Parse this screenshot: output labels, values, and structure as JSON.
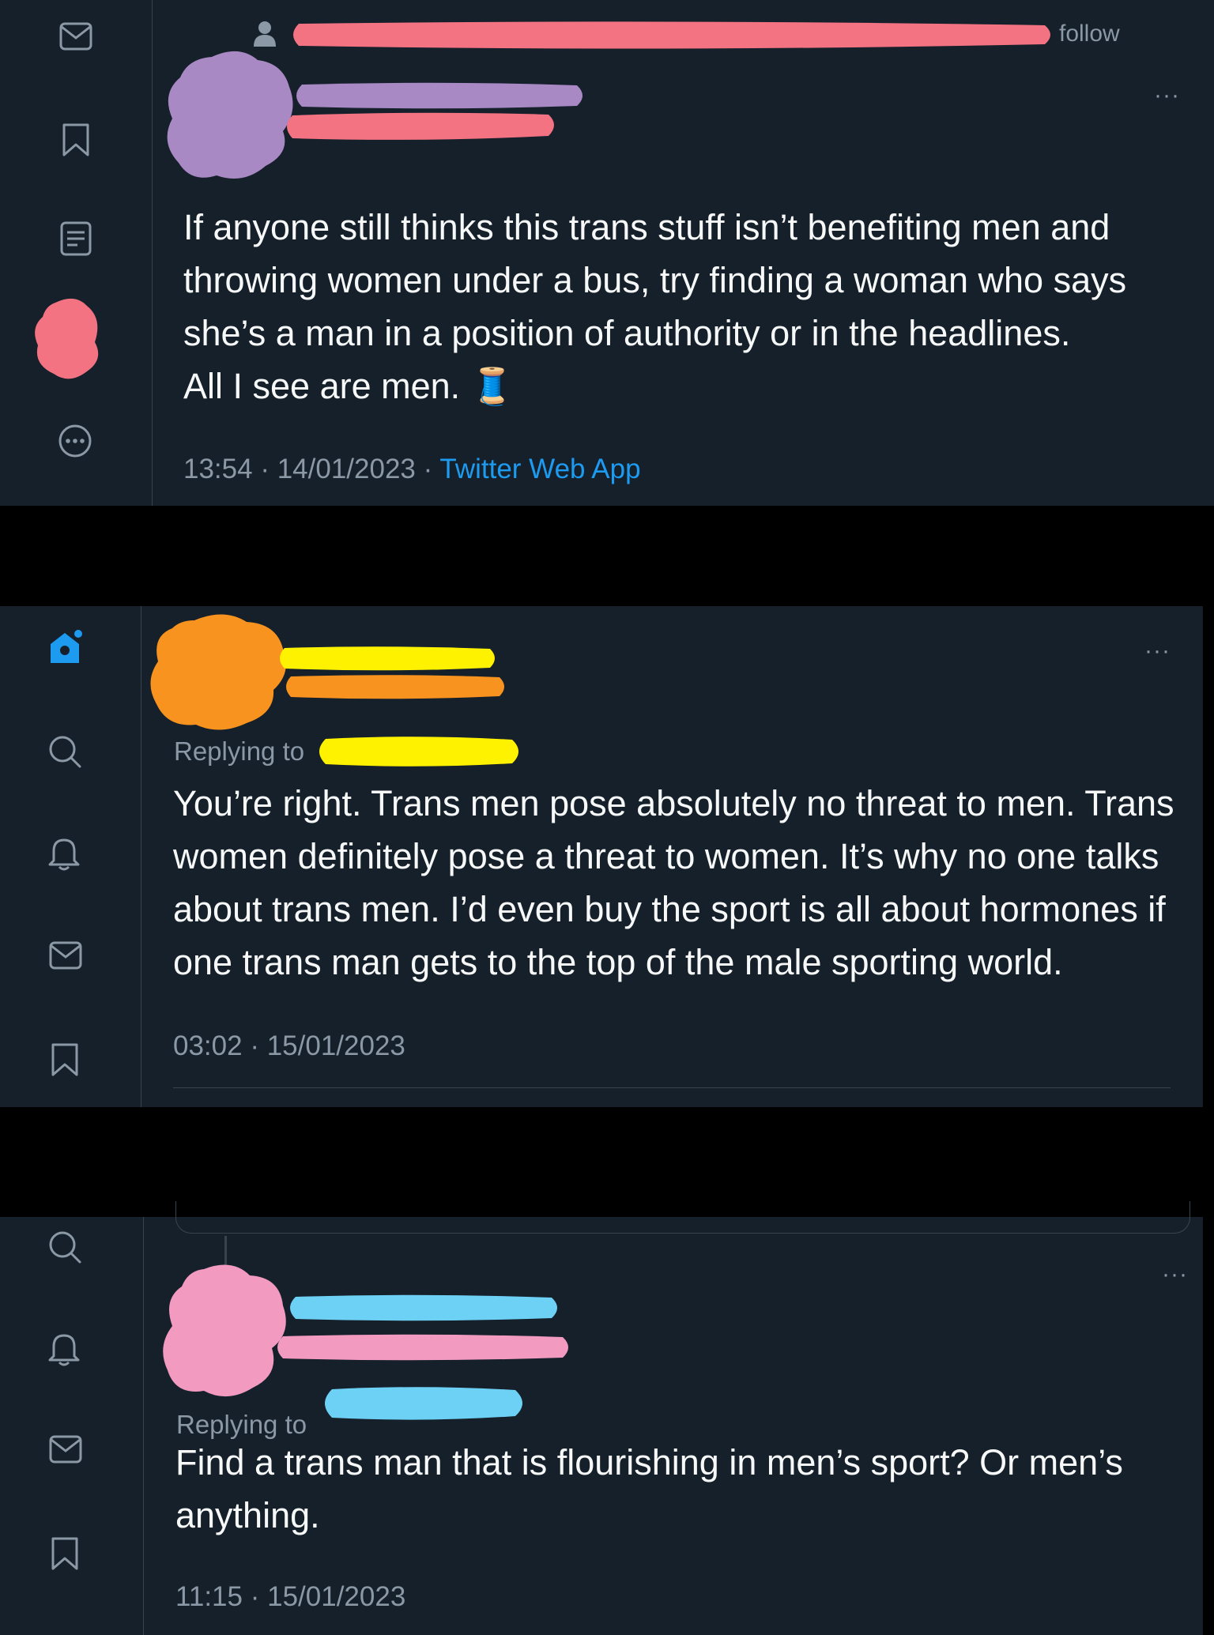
{
  "tweet1": {
    "follow_label": "follow",
    "more_label": "···",
    "text_lines": [
      "If anyone still thinks this trans stuff isn’t benefiting men and",
      "throwing women under a bus, try finding a woman who says",
      "she’s a man in a position of authority or in the headlines.",
      "All I see are men. 🧵"
    ],
    "time": "13:54",
    "date": "14/01/2023",
    "source": "Twitter Web App",
    "separator": "·"
  },
  "tweet2": {
    "more_label": "···",
    "replying_to_label": "Replying to",
    "text_lines": [
      "You’re right. Trans men pose absolutely no threat to men. Trans",
      "women definitely pose a threat to women. It’s why no one talks",
      "about trans men. I’d even buy the sport is all about hormones if",
      "one trans man gets to the top of the male sporting world."
    ],
    "time": "03:02",
    "date": "15/01/2023",
    "separator": "·"
  },
  "tweet3": {
    "more_label": "···",
    "replying_to_label": "Replying to",
    "text_lines": [
      "Find a trans man that is flourishing in men’s sport? Or men’s",
      "anything."
    ],
    "time": "11:15",
    "date": "15/01/2023",
    "separator": "·"
  },
  "icons": {
    "rail1": [
      "mail-icon",
      "bookmark-icon",
      "lists-icon",
      "profile-avatar-redacted",
      "more-circle-icon"
    ],
    "rail2": [
      "home-icon",
      "search-icon",
      "notifications-bell-icon",
      "mail-icon",
      "bookmark-icon"
    ],
    "rail3": [
      "search-icon",
      "notifications-bell-icon",
      "mail-icon",
      "bookmark-icon"
    ]
  },
  "colors": {
    "background": "#15202b",
    "text": "#f7f9f9",
    "muted": "#8b98a5",
    "link": "#1d9bf0",
    "redaction_pink_red": "#f47383",
    "redaction_purple": "#a889c4",
    "redaction_orange": "#f7931e",
    "redaction_yellow": "#fff200",
    "redaction_pink": "#f29ac0",
    "redaction_blue": "#6dd0f5"
  }
}
